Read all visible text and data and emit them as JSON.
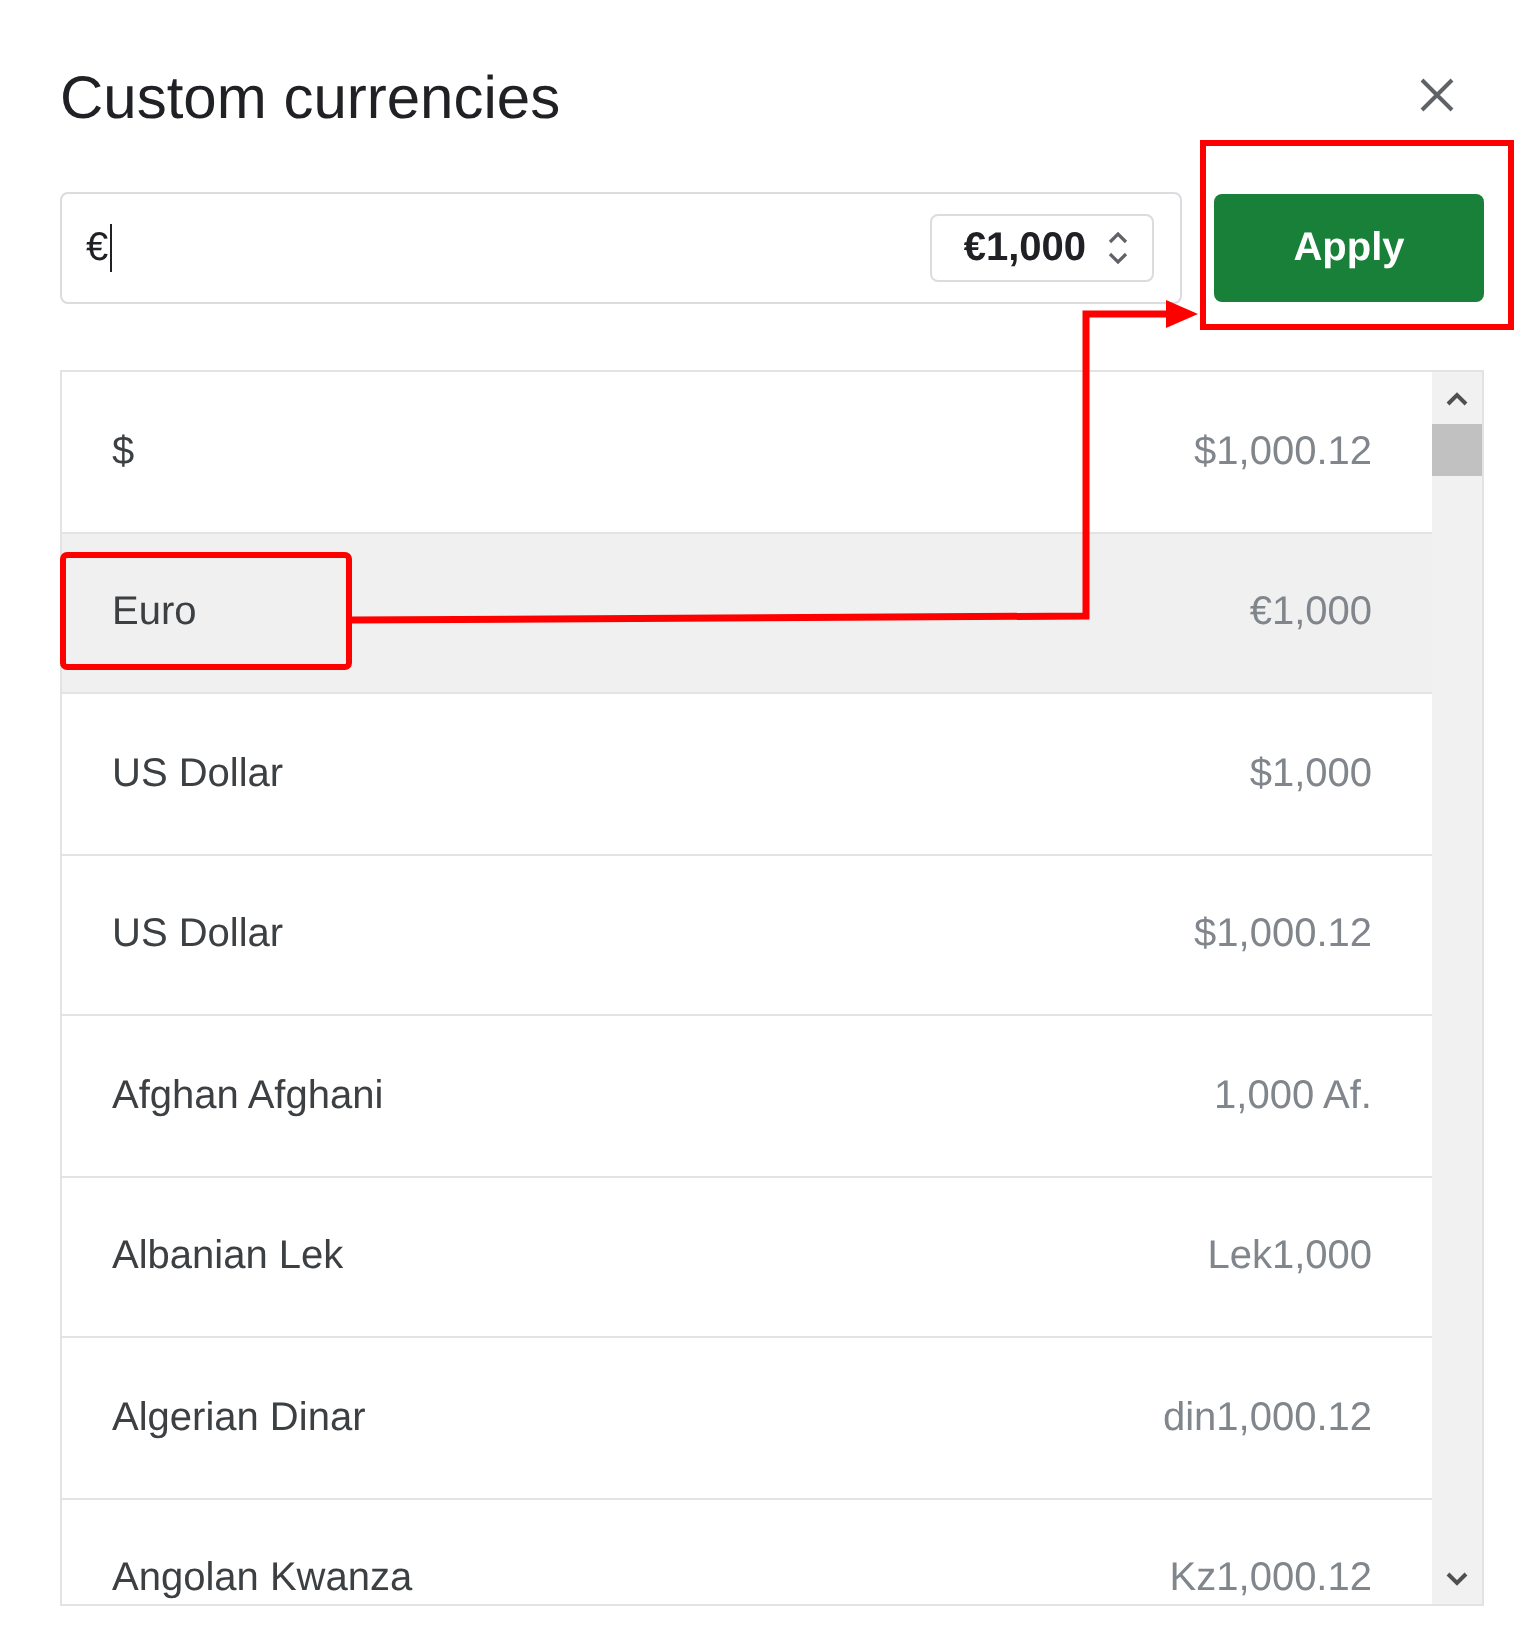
{
  "dialog": {
    "title": "Custom currencies"
  },
  "currency_field": {
    "value": "€",
    "format": "€1,000"
  },
  "apply_button": {
    "label": "Apply"
  },
  "currencies": [
    {
      "name": "$",
      "example": "$1,000.12",
      "selected": false
    },
    {
      "name": "Euro",
      "example": "€1,000",
      "selected": true
    },
    {
      "name": "US Dollar",
      "example": "$1,000",
      "selected": false
    },
    {
      "name": "US Dollar",
      "example": "$1,000.12",
      "selected": false
    },
    {
      "name": "Afghan Afghani",
      "example": "1,000 Af.",
      "selected": false
    },
    {
      "name": "Albanian Lek",
      "example": "Lek1,000",
      "selected": false
    },
    {
      "name": "Algerian Dinar",
      "example": "din1,000.12",
      "selected": false
    },
    {
      "name": "Angolan Kwanza",
      "example": "Kz1,000.12",
      "selected": false
    }
  ]
}
